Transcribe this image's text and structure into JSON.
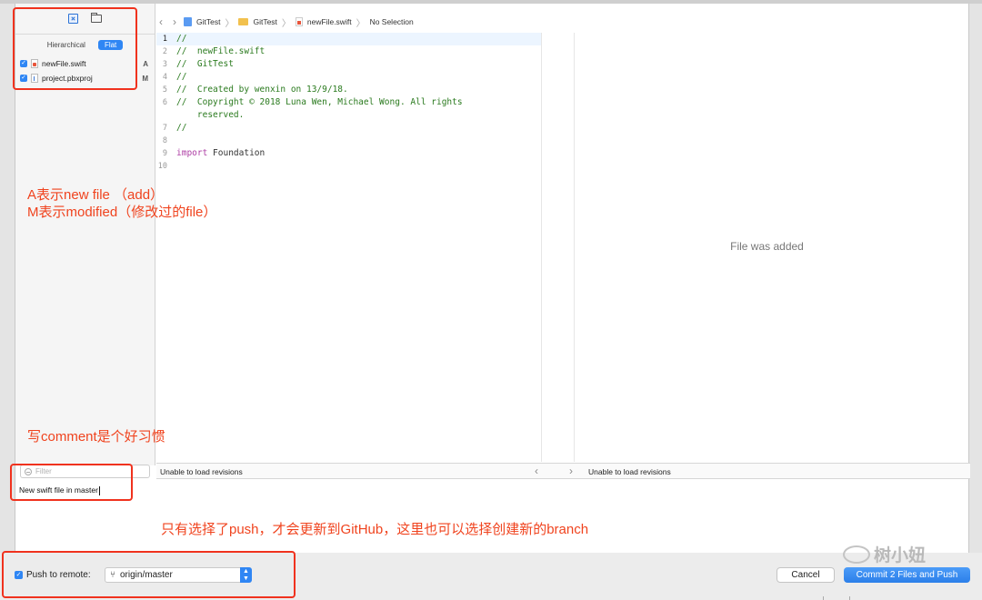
{
  "sidebar": {
    "segments": {
      "hierarchical": "Hierarchical",
      "flat": "Flat"
    },
    "files": [
      {
        "name": "newFile.swift",
        "status": "A",
        "icon": "swift-file-icon"
      },
      {
        "name": "project.pbxproj",
        "status": "M",
        "icon": "pbxproj-file-icon"
      }
    ],
    "filter_placeholder": "Filter"
  },
  "breadcrumb": {
    "items": [
      "GitTest",
      "GitTest",
      "newFile.swift",
      "No Selection"
    ]
  },
  "editor": {
    "lines": [
      {
        "n": "1",
        "text": "//"
      },
      {
        "n": "2",
        "text": "//  newFile.swift"
      },
      {
        "n": "3",
        "text": "//  GitTest"
      },
      {
        "n": "4",
        "text": "//"
      },
      {
        "n": "5",
        "text": "//  Created by wenxin on 13/9/18."
      },
      {
        "n": "6",
        "text": "//  Copyright © 2018 Luna Wen, Michael Wong. All rights"
      },
      {
        "n": "",
        "text": "    reserved."
      },
      {
        "n": "7",
        "text": "//"
      },
      {
        "n": "8",
        "text": ""
      },
      {
        "n": "9",
        "kw": "import",
        "text": " Foundation"
      },
      {
        "n": "10",
        "text": ""
      }
    ]
  },
  "right_pane": {
    "message": "File was added"
  },
  "revisions": {
    "left": "Unable to load revisions",
    "right": "Unable to load revisions"
  },
  "commit": {
    "message": "New swift file in master"
  },
  "bottom": {
    "push_label": "Push to remote:",
    "remote_value": "origin/master",
    "cancel_label": "Cancel",
    "commit_label": "Commit 2 Files and Push"
  },
  "annotations": {
    "note1_line1": "A表示new file （add）",
    "note1_line2": "M表示modified（修改过的file）",
    "note2": "写comment是个好习惯",
    "note3": "只有选择了push，才会更新到GitHub，这里也可以选择创建新的branch"
  },
  "watermark": {
    "text": "树小妞"
  },
  "colors": {
    "accent": "#2f86f4",
    "annotation": "#f0321e",
    "comment": "#2a7a1e",
    "keyword": "#ad3da4"
  }
}
